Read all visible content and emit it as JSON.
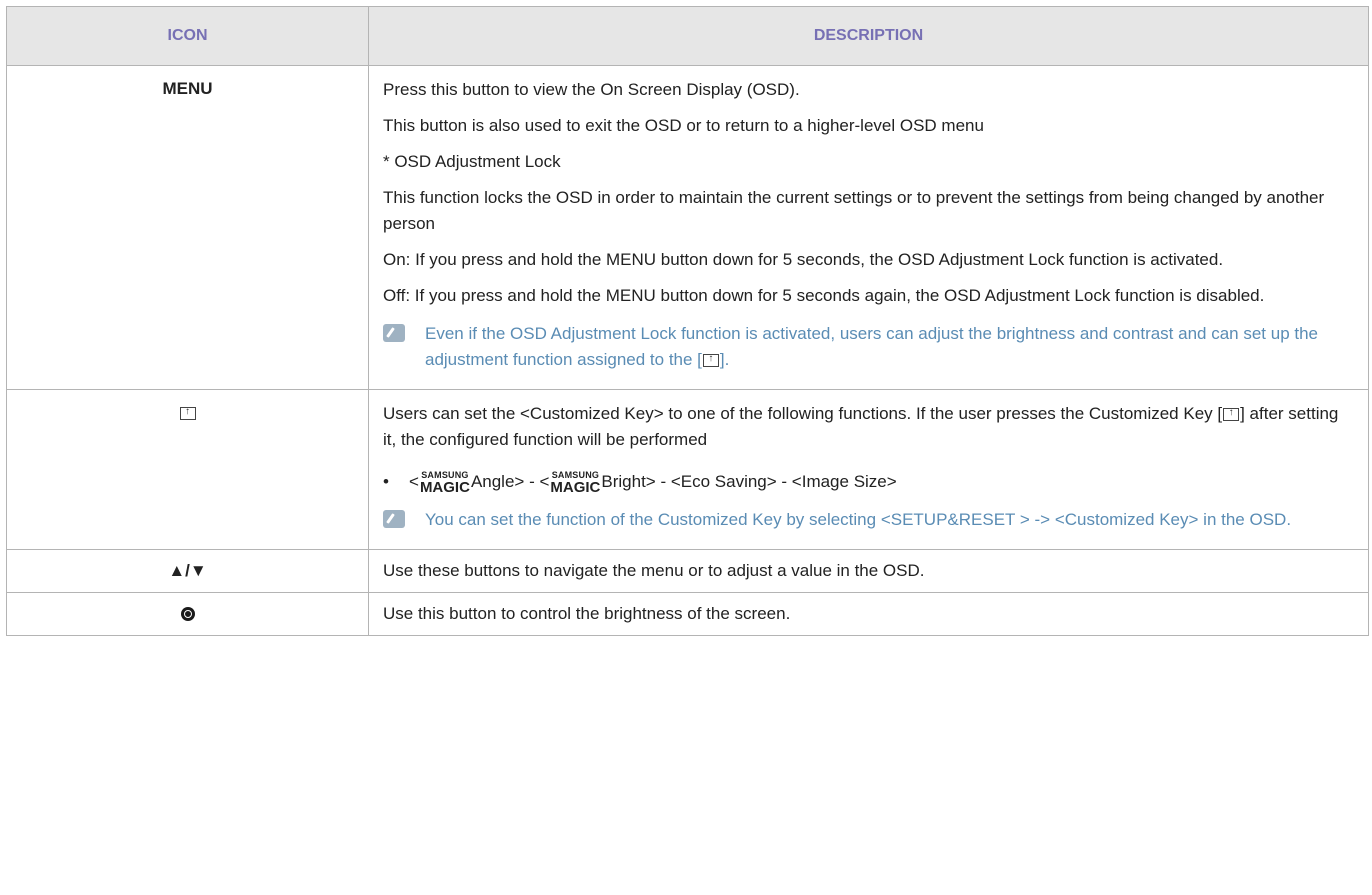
{
  "header": {
    "icon_col": "ICON",
    "desc_col": "DESCRIPTION"
  },
  "rows": {
    "menu": {
      "icon_label": "MENU",
      "p1": "Press this button to view the On Screen Display (OSD).",
      "p2": "This button is also used to exit the OSD or to return to a higher-level OSD menu",
      "p3": "* OSD Adjustment Lock",
      "p4": "This function locks the OSD in order to maintain the current settings or to prevent the settings from being changed by another person",
      "p5": "On: If you press and hold the MENU button down for 5 seconds, the OSD Adjustment Lock function is activated.",
      "p6": "Off: If you press and hold the MENU button down for 5 seconds again, the OSD Adjustment Lock function is disabled.",
      "note_before": "Even if the OSD Adjustment Lock function is activated, users can adjust the brightness and contrast and can set up the adjustment function assigned to the [",
      "note_after": "]."
    },
    "customized": {
      "p1_before": "Users can set the <Customized Key> to one of the following functions. If the user presses the Customized Key [",
      "p1_after": "] after setting it, the configured function will be performed",
      "bullet_glyph": "•",
      "magic_top": "SAMSUNG",
      "magic_bottom": "MAGIC",
      "bullet_open1": "<",
      "bullet_angle": "Angle> - <",
      "bullet_bright": "Bright> - <Eco Saving> - <Image Size>",
      "note": "You can set the function of the Customized Key by selecting <SETUP&RESET > -> <Customized Key> in the OSD."
    },
    "updown": {
      "icon_label": "▲/▼",
      "desc": "Use these buttons to navigate the menu or to adjust a value in the OSD."
    },
    "brightness": {
      "desc": "Use this button to control the brightness of the screen."
    }
  },
  "colors": {
    "header_text": "#7770b4",
    "header_bg": "#e6e6e6",
    "note_text": "#5a8cb4",
    "border": "#b4b4b4"
  },
  "icons": [
    "note-pencil-icon",
    "customized-key-icon",
    "brightness-button-icon"
  ]
}
